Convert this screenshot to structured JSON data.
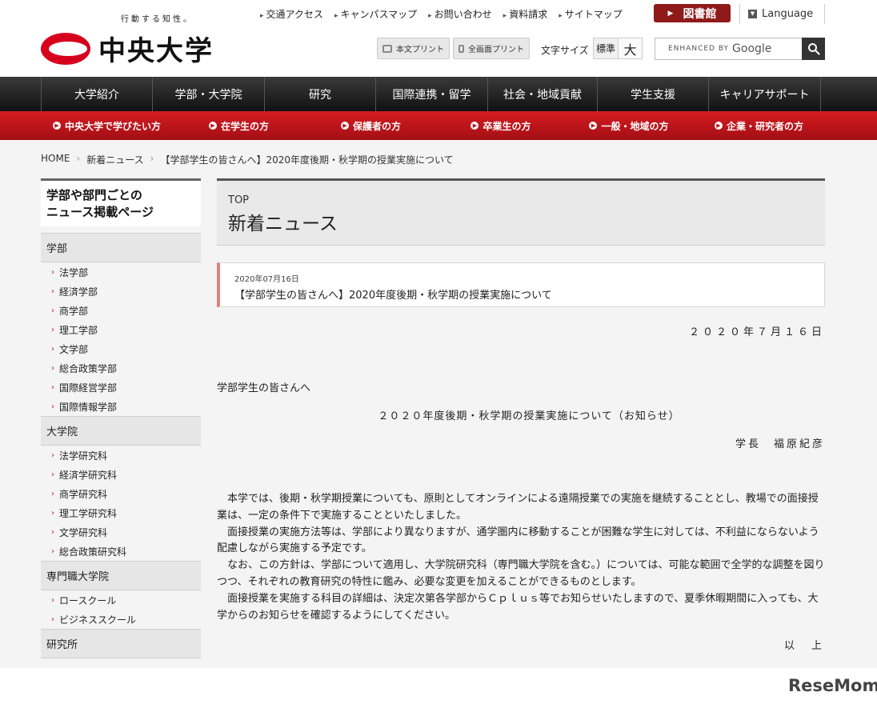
{
  "header": {
    "tagline": "行動する知性。",
    "logo_text": "中央大学",
    "utility_links": [
      "交通アクセス",
      "キャンパスマップ",
      "お問い合わせ",
      "資料請求",
      "サイトマップ"
    ],
    "library_label": "図書館",
    "language_label": "Language",
    "print_body_label": "本文プリント",
    "print_full_label": "全画面プリント",
    "font_size_label": "文字サイズ",
    "font_standard": "標準",
    "font_large": "大",
    "search_placeholder": "ENHANCED BY",
    "search_brand": "Google"
  },
  "global_nav": [
    "大学紹介",
    "学部・大学院",
    "研究",
    "国際連携・留学",
    "社会・地域貢献",
    "学生支援",
    "キャリアサポート"
  ],
  "sub_nav": [
    "中央大学で学びたい方",
    "在学生の方",
    "保護者の方",
    "卒業生の方",
    "一般・地域の方",
    "企業・研究者の方"
  ],
  "breadcrumb": [
    "HOME",
    "新着ニュース",
    "【学部学生の皆さんへ】2020年度後期・秋学期の授業実施について"
  ],
  "sidebar": {
    "title_line1": "学部や部門ごとの",
    "title_line2": "ニュース掲載ページ",
    "groups": [
      {
        "label": "学部",
        "items": [
          "法学部",
          "経済学部",
          "商学部",
          "理工学部",
          "文学部",
          "総合政策学部",
          "国際経営学部",
          "国際情報学部"
        ]
      },
      {
        "label": "大学院",
        "items": [
          "法学研究科",
          "経済学研究科",
          "商学研究科",
          "理工学研究科",
          "文学研究科",
          "総合政策研究科"
        ]
      },
      {
        "label": "専門職大学院",
        "items": [
          "ロースクール",
          "ビジネススクール"
        ]
      },
      {
        "label": "研究所",
        "items": []
      }
    ]
  },
  "content": {
    "top_label": "TOP",
    "page_title": "新着ニュース",
    "news_date": "2020年07月16日",
    "news_title": "【学部学生の皆さんへ】2020年度後期・秋学期の授業実施について",
    "doc_date": "２０２０年７月１６日",
    "doc_to": "学部学生の皆さんへ",
    "doc_heading": "２０２０年度後期・秋学期の授業実施について（お知らせ）",
    "doc_signature": "学長　福原紀彦",
    "paragraphs": [
      "本学では、後期・秋学期授業についても、原則としてオンラインによる遠隔授業での実施を継続することとし、教場での面接授業は、一定の条件下で実施することといたしました。",
      "面接授業の実施方法等は、学部により異なりますが、通学圏内に移動することが困難な学生に対しては、不利益にならないよう配慮しながら実施する予定です。",
      "なお、この方針は、学部について適用し、大学院研究科（専門職大学院を含む。）については、可能な範囲で全学的な調整を図りつつ、それぞれの教育研究の特性に鑑み、必要な変更を加えることができるものとします。",
      "面接授業を実施する科目の詳細は、決定次第各学部からＣｐｌｕｓ等でお知らせいたしますので、夏季休暇期間に入っても、大学からのお知らせを確認するようにしてください。"
    ],
    "doc_end": "以　上"
  },
  "watermark": "ReseMom",
  "colors": {
    "brand_red": "#d6001c",
    "subnav_red": "#b5151a",
    "library_btn": "#8e1a1a"
  }
}
